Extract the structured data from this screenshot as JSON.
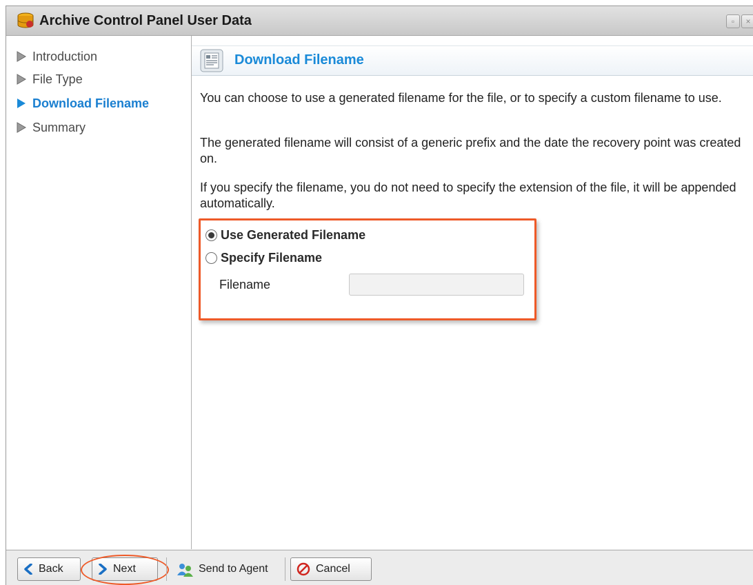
{
  "window": {
    "title": "Archive Control Panel User Data"
  },
  "sidebar": {
    "items": [
      {
        "label": "Introduction",
        "active": false
      },
      {
        "label": "File Type",
        "active": false
      },
      {
        "label": "Download Filename",
        "active": true
      },
      {
        "label": "Summary",
        "active": false
      }
    ]
  },
  "content": {
    "header_title": "Download Filename",
    "paragraphs": [
      "You can choose to use a generated filename for the file, or to specify a custom filename to use.",
      "The generated filename will consist of a generic prefix and the date the recovery point was created on.",
      "If you specify the filename, you do not need to specify the extension of the file, it will be appended automatically."
    ],
    "options": [
      {
        "label": "Use Generated Filename",
        "selected": true
      },
      {
        "label": "Specify Filename",
        "selected": false
      }
    ],
    "filename_label": "Filename",
    "filename_value": ""
  },
  "footer": {
    "back_label": "Back",
    "next_label": "Next",
    "send_label": "Send to Agent",
    "cancel_label": "Cancel"
  },
  "colors": {
    "accent": "#1a8ad8",
    "highlight": "#ee5a28"
  }
}
